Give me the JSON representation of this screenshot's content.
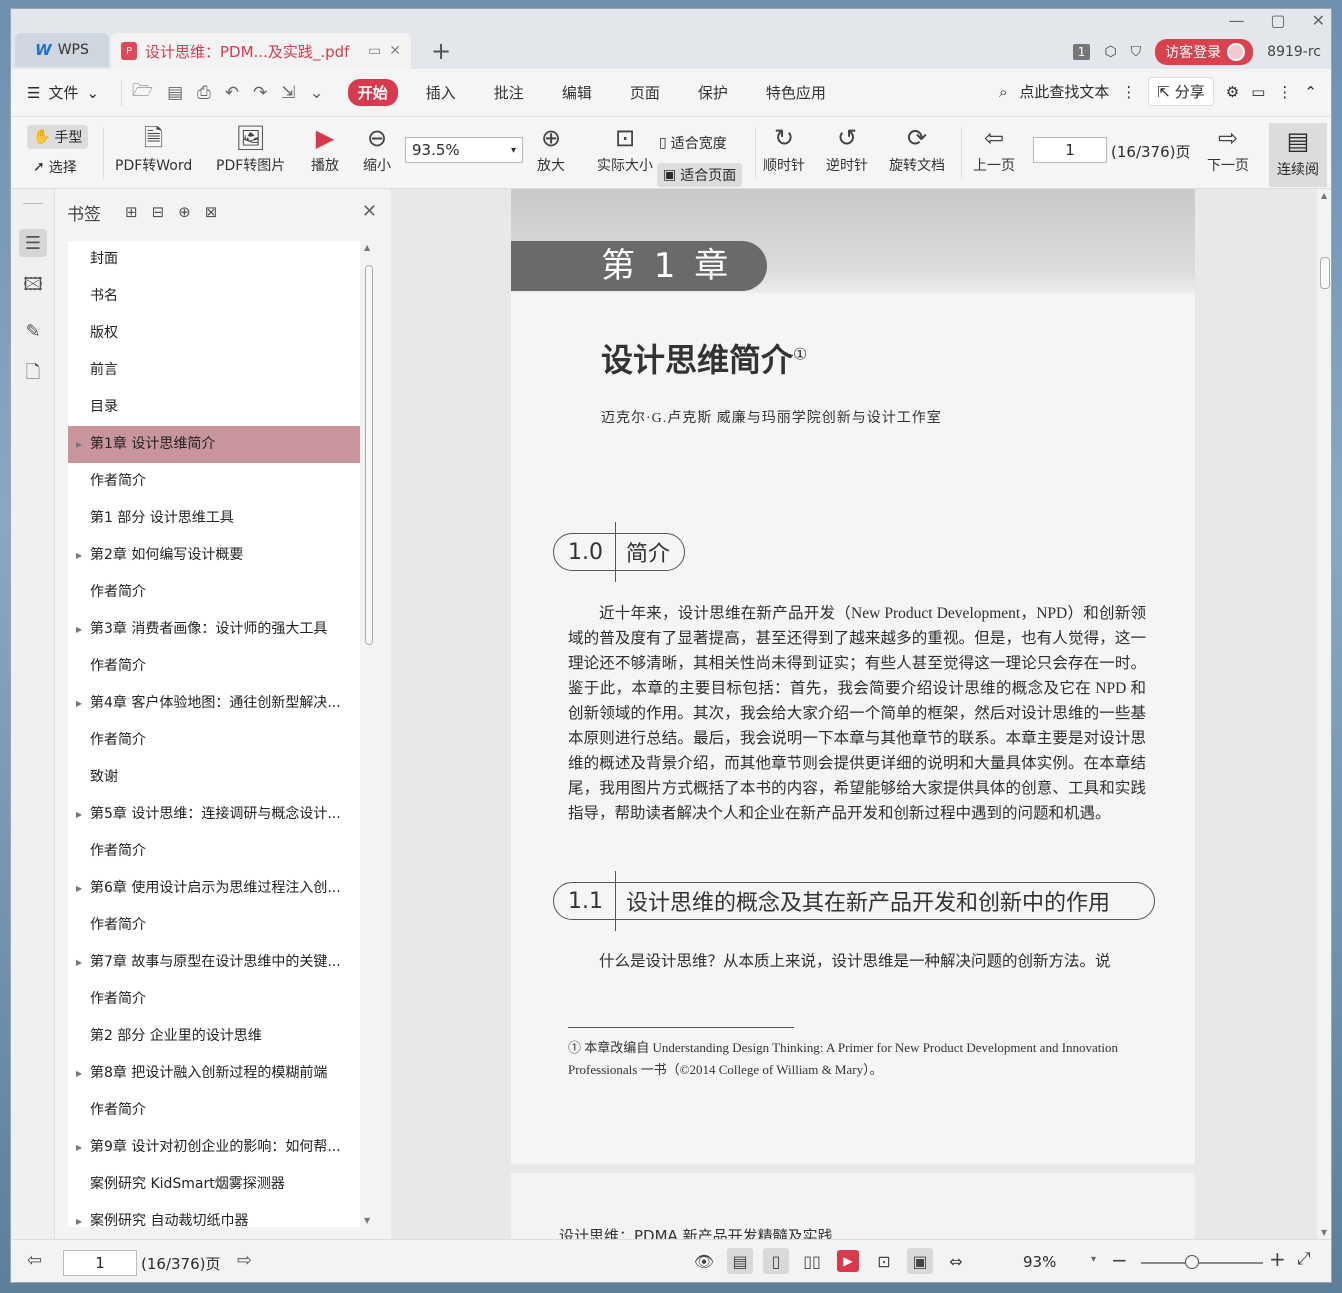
{
  "app": {
    "name": "WPS",
    "doc_tab_title": "设计思维：PDM...及实践_.pdf",
    "page_indicator": "1",
    "login_label": "访客登录",
    "user_id": "8919-rc"
  },
  "menubar": {
    "file_label": "文件",
    "tabs": [
      {
        "label": "开始",
        "active": true
      },
      {
        "label": "插入",
        "active": false
      },
      {
        "label": "批注",
        "active": false
      },
      {
        "label": "编辑",
        "active": false
      },
      {
        "label": "页面",
        "active": false
      },
      {
        "label": "保护",
        "active": false
      },
      {
        "label": "特色应用",
        "active": false
      }
    ],
    "search_label": "点此查找文本",
    "share_label": "分享"
  },
  "toolbar": {
    "hand_label": "手型",
    "select_label": "选择",
    "pdf_to_word": "PDF转Word",
    "pdf_to_image": "PDF转图片",
    "play": "播放",
    "zoom_out": "缩小",
    "zoom_value": "93.5%",
    "zoom_in": "放大",
    "actual_size": "实际大小",
    "fit_width": "适合宽度",
    "fit_page": "适合页面",
    "clockwise": "顺时针",
    "counterclockwise": "逆时针",
    "rotate_doc": "旋转文档",
    "prev_page": "上一页",
    "page_value": "1",
    "page_total": "(16/376)页",
    "next_page": "下一页",
    "continuous": "连续阅"
  },
  "bookmarks": {
    "title": "书签",
    "items": [
      {
        "label": "封面",
        "expandable": false,
        "selected": false
      },
      {
        "label": "书名",
        "expandable": false,
        "selected": false
      },
      {
        "label": "版权",
        "expandable": false,
        "selected": false
      },
      {
        "label": "前言",
        "expandable": false,
        "selected": false
      },
      {
        "label": "目录",
        "expandable": false,
        "selected": false
      },
      {
        "label": "第1章 设计思维简介",
        "expandable": true,
        "selected": true
      },
      {
        "label": "作者简介",
        "expandable": false,
        "selected": false
      },
      {
        "label": "第1 部分 设计思维工具",
        "expandable": false,
        "selected": false
      },
      {
        "label": "第2章 如何编写设计概要",
        "expandable": true,
        "selected": false
      },
      {
        "label": "作者简介",
        "expandable": false,
        "selected": false
      },
      {
        "label": "第3章 消费者画像：设计师的强大工具",
        "expandable": true,
        "selected": false
      },
      {
        "label": "作者简介",
        "expandable": false,
        "selected": false
      },
      {
        "label": "第4章 客户体验地图：通往创新型解决...",
        "expandable": true,
        "selected": false
      },
      {
        "label": "作者简介",
        "expandable": false,
        "selected": false
      },
      {
        "label": "致谢",
        "expandable": false,
        "selected": false
      },
      {
        "label": "第5章 设计思维：连接调研与概念设计...",
        "expandable": true,
        "selected": false
      },
      {
        "label": "作者简介",
        "expandable": false,
        "selected": false
      },
      {
        "label": "第6章 使用设计启示为思维过程注入创...",
        "expandable": true,
        "selected": false
      },
      {
        "label": "作者简介",
        "expandable": false,
        "selected": false
      },
      {
        "label": "第7章 故事与原型在设计思维中的关键...",
        "expandable": true,
        "selected": false
      },
      {
        "label": "作者简介",
        "expandable": false,
        "selected": false
      },
      {
        "label": "第2 部分 企业里的设计思维",
        "expandable": false,
        "selected": false
      },
      {
        "label": "第8章 把设计融入创新过程的模糊前端",
        "expandable": true,
        "selected": false
      },
      {
        "label": "作者简介",
        "expandable": false,
        "selected": false
      },
      {
        "label": "第9章 设计对初创企业的影响：如何帮...",
        "expandable": true,
        "selected": false
      },
      {
        "label": "案例研究 KidSmart烟雾探测器",
        "expandable": false,
        "selected": false
      },
      {
        "label": "案例研究 自动裁切纸巾器",
        "expandable": true,
        "selected": false
      }
    ]
  },
  "page": {
    "chapter": "第 1 章",
    "title": "设计思维简介",
    "title_note": "①",
    "author": "迈克尔·G.卢克斯  威廉与玛丽学院创新与设计工作室",
    "sec1_num": "1.0",
    "sec1_title": "简介",
    "para1": "近十年来，设计思维在新产品开发（New Product Development，NPD）和创新领域的普及度有了显著提高，甚至还得到了越来越多的重视。但是，也有人觉得，这一理论还不够清晰，其相关性尚未得到证实；有些人甚至觉得这一理论只会存在一时。鉴于此，本章的主要目标包括：首先，我会简要介绍设计思维的概念及它在 NPD 和创新领域的作用。其次，我会给大家介绍一个简单的框架，然后对设计思维的一些基本原则进行总结。最后，我会说明一下本章与其他章节的联系。本章主要是对设计思维的概述及背景介绍，而其他章节则会提供更详细的说明和大量具体实例。在本章结尾，我用图片方式概括了本书的内容，希望能够给大家提供具体的创意、工具和实践指导，帮助读者解决个人和企业在新产品开发和创新过程中遇到的问题和机遇。",
    "sec2_num": "1.1",
    "sec2_title": "设计思维的概念及其在新产品开发和创新中的作用",
    "para2": "什么是设计思维？从本质上来说，设计思维是一种解决问题的创新方法。说",
    "footnote": "① 本章改编自 Understanding Design Thinking: A Primer for New Product Development and Innovation Professionals 一书（©2014 College of William & Mary）。",
    "next_page_header": "设计思维：PDMA 新产品开发精髓及实践"
  },
  "statusbar": {
    "page_value": "1",
    "page_total": "(16/376)页",
    "zoom": "93%"
  },
  "colors": {
    "accent": "#d8394d",
    "bookmark_selected": "#c8959d"
  }
}
